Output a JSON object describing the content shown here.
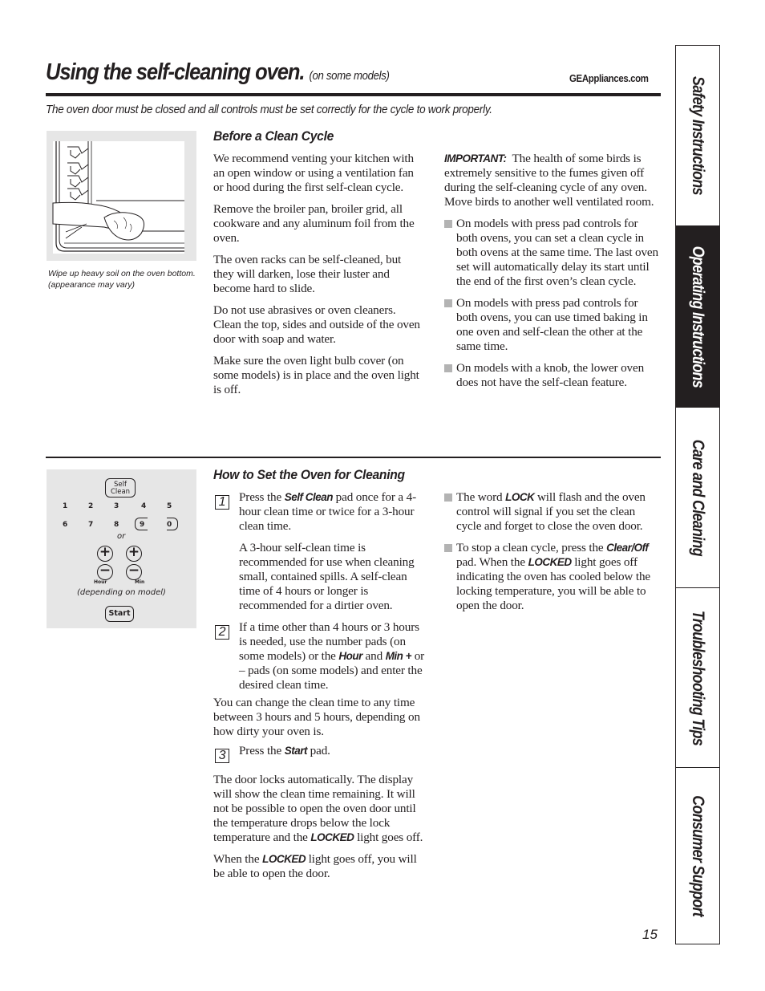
{
  "header": {
    "title": "Using the self-cleaning oven.",
    "title_note": "(on some models)",
    "website": "GEAppliances.com",
    "intro": "The oven door must be closed and all controls must be set correctly for the cycle to work properly."
  },
  "before_clean": {
    "heading": "Before a Clean Cycle",
    "figure_caption": "Wipe up heavy soil on the oven bottom. (appearance may vary)",
    "paragraphs": [
      "We recommend venting your kitchen with an open window or using a ventilation fan or hood during the first self-clean cycle.",
      "Remove the broiler pan, broiler grid, all cookware and any aluminum foil from the oven.",
      "The oven racks can be self-cleaned, but they will darken, lose their luster and become hard to slide.",
      "Do not use abrasives or oven cleaners. Clean the top, sides and outside of the oven door with soap and water.",
      "Make sure the oven light bulb cover (on some models) is in place and the oven light is off."
    ],
    "important_label": "IMPORTANT:",
    "important_text": "The health of some birds is extremely sensitive to the fumes given off during the self-cleaning cycle of any oven. Move birds to another well ventilated room.",
    "bullets": [
      "On models with press pad controls for both ovens, you can set a clean cycle in both ovens at the same time. The last oven set will automatically delay its start until the end of the first oven’s clean cycle.",
      "On models with press pad controls for both ovens, you can use timed baking in one oven and self-clean the other at the same time.",
      "On models with a knob, the lower oven does not have the self-clean feature."
    ]
  },
  "how_to": {
    "heading": "How to Set the Oven for Cleaning",
    "keypad": {
      "self_clean_line1": "Self",
      "self_clean_line2": "Clean",
      "digits_row1": [
        "1",
        "2",
        "3",
        "4",
        "5"
      ],
      "digits_row2": [
        "6",
        "7",
        "8",
        "9",
        "0"
      ],
      "or": "or",
      "plus": "+",
      "minus": "−",
      "hour_label": "Hour",
      "min_label": "Min",
      "note": "(depending on model)",
      "start": "Start"
    },
    "steps": [
      {
        "number": "1",
        "pre": "Press the",
        "bold": "Self Clean",
        "post": "pad once for a 4-hour clean time or twice for a 3-hour clean time.",
        "extra": "A 3-hour self-clean time is recommended for use when cleaning small, contained spills. A self-clean time of 4 hours or longer is recommended for a dirtier oven."
      },
      {
        "number": "2",
        "pre": "If a time other than 4 hours or 3 hours is needed, use the number pads (on some models) or the",
        "bold": "Hour",
        "mid": "and",
        "bold2": "Min +",
        "post": "or – pads (on some models) and enter the desired clean time."
      },
      {
        "number": "3",
        "pre": "Press the",
        "bold": "Start",
        "post": "pad."
      }
    ],
    "change_time": "You can change the clean time to any time between 3 hours and 5 hours, depending on how dirty your oven is.",
    "door_locks_pre": "The door locks automatically. The display will show the clean time remaining. It will not be possible to open the oven door until the temperature drops below the lock temperature and the",
    "locked": "LOCKED",
    "door_locks_post": "light goes off.",
    "when_pre": "When the",
    "when_post": "light goes off, you will be able to open the door.",
    "bullet1_pre": "The word",
    "bullet1_bold": "LOCK",
    "bullet1_post": "will flash and the oven control will signal if you set the clean cycle and forget to close the oven door.",
    "bullet2_pre": "To stop a clean cycle, press the",
    "bullet2_bold": "Clear/Off",
    "bullet2_mid": "pad. When the",
    "bullet2_post": "light goes off indicating the oven has cooled below the locking temperature, you will be able to open the door."
  },
  "side_tabs": [
    {
      "label": "Safety Instructions",
      "active": false
    },
    {
      "label": "Operating Instructions",
      "active": true
    },
    {
      "label": "Care and Cleaning",
      "active": false
    },
    {
      "label": "Troubleshooting Tips",
      "active": false
    },
    {
      "label": "Consumer Support",
      "active": false
    }
  ],
  "page_number": "15"
}
